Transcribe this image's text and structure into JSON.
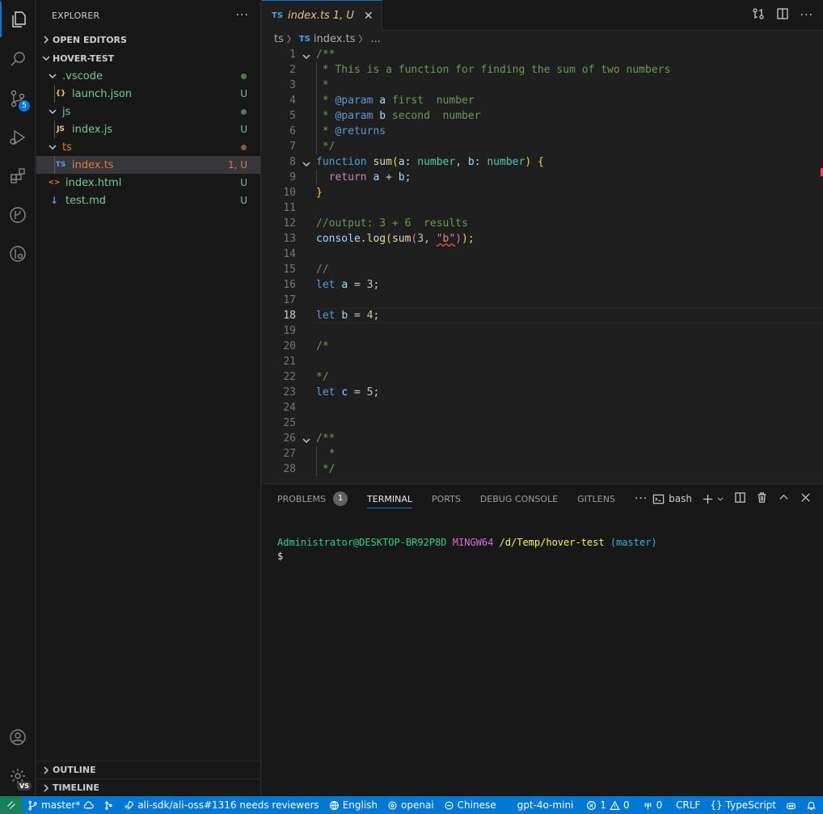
{
  "explorer": {
    "title": "EXPLORER",
    "more": "···",
    "open_editors": "OPEN EDITORS",
    "project": "HOVER-TEST",
    "outline": "OUTLINE",
    "timeline": "TIMELINE",
    "items": [
      {
        "label": ".vscode",
        "status": ""
      },
      {
        "label": "launch.json",
        "icon": "{}",
        "status": "U"
      },
      {
        "label": "js",
        "status": ""
      },
      {
        "label": "index.js",
        "icon": "JS",
        "status": "U"
      },
      {
        "label": "ts",
        "status": ""
      },
      {
        "label": "index.ts",
        "icon": "TS",
        "status": "1, U"
      },
      {
        "label": "index.html",
        "icon": "<>",
        "status": "U"
      },
      {
        "label": "test.md",
        "icon": "↓",
        "status": "U"
      }
    ]
  },
  "activity": {
    "scm_badge": "5",
    "vs_badge": "VS"
  },
  "editor": {
    "tab": {
      "icon": "TS",
      "label": "index.ts",
      "status": "1, U",
      "close": "✕"
    },
    "breadcrumb": {
      "folder": "ts",
      "icon": "TS",
      "file": "index.ts",
      "more": "..."
    },
    "line_numbers": [
      "1",
      "2",
      "3",
      "4",
      "5",
      "6",
      "7",
      "8",
      "9",
      "10",
      "11",
      "12",
      "13",
      "14",
      "15",
      "16",
      "17",
      "18",
      "19",
      "20",
      "21",
      "22",
      "23",
      "24",
      "25",
      "26",
      "27",
      "28"
    ],
    "current_line": "18"
  },
  "code": {
    "l1": "/**",
    "l2": " * This is a function for finding the sum of two numbers",
    "l3": " *",
    "l4a": " * ",
    "l4b": "@param",
    "l4c": " a",
    "l4d": " first  number",
    "l5a": " * ",
    "l5b": "@param",
    "l5c": " b",
    "l5d": " second  number",
    "l6a": " * ",
    "l6b": "@returns",
    "l7": " */",
    "l8": [
      "function",
      " ",
      "sum",
      "(",
      "a",
      ": ",
      "number",
      ", ",
      "b",
      ": ",
      "number",
      ")",
      " {"
    ],
    "l9": [
      "  ",
      "return",
      " ",
      "a",
      " + ",
      "b",
      ";"
    ],
    "l10": "}",
    "l12": "//output: 3 + 6  results",
    "l13": [
      "console",
      ".",
      "log",
      "(",
      "sum",
      "(",
      "3",
      ", ",
      "\"b\"",
      ")",
      ")",
      ";"
    ],
    "l15": "//",
    "l16": [
      "let",
      " ",
      "a",
      " = ",
      "3",
      ";"
    ],
    "l18": [
      "let",
      " ",
      "b",
      " = ",
      "4",
      ";"
    ],
    "l20": "/*",
    "l22": "*/",
    "l23": [
      "let",
      " ",
      "c",
      " = ",
      "5",
      ";"
    ],
    "l26": "/**",
    "l27": "  *",
    "l28": " */"
  },
  "panel": {
    "tabs": [
      "PROBLEMS",
      "TERMINAL",
      "PORTS",
      "DEBUG CONSOLE",
      "GITLENS"
    ],
    "problems_count": "1",
    "more": "···",
    "shell": "bash",
    "prompt": {
      "user": "Administrator@DESKTOP-BR92P8D",
      "sys": "MINGW64",
      "path": "/d/Temp/hover-test",
      "branch": "(master)",
      "symbol": "$"
    }
  },
  "statusbar": {
    "branch": "master*",
    "pr": "ali-sdk/ali-oss#1316 needs reviewers",
    "language_ui": "English",
    "openai": "openai",
    "chinese": "Chinese",
    "model": "gpt-4o-mini",
    "errors": "1",
    "warnings": "0",
    "ports": "0",
    "eol": "CRLF",
    "lang": "TypeScript"
  }
}
